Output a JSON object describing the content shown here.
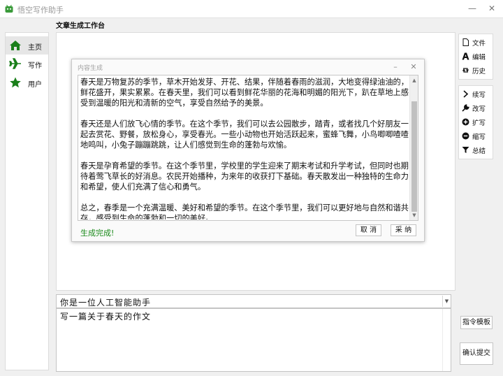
{
  "app": {
    "title": "悟空写作助手",
    "icon": "android-robot-icon",
    "accent_color": "#1a7f1a"
  },
  "sidebar": {
    "items": [
      {
        "label": "主页",
        "icon": "home-icon",
        "active": true
      },
      {
        "label": "写作",
        "icon": "airplane-icon",
        "active": false
      },
      {
        "label": "用户",
        "icon": "star-icon",
        "active": false
      }
    ]
  },
  "workspace": {
    "title": "文章生成工作台"
  },
  "dialog": {
    "title": "内容生成",
    "paragraphs": [
      "春天是万物复苏的季节，草木开始发芽、开花、结果，伴随着春雨的滋润，大地变得绿油油的，鲜花盛开，果实累累。在春天里，我们可以看到鲜花华丽的花海和明媚的阳光下，趴在草地上感受到温暖的阳光和清新的空气，享受自然给予的美景。",
      "春天还是人们放飞心情的季节。在这个季节，我们可以去公园散步，踏青，或者找几个好朋友一起去赏花、野餐，放松身心，享受春光。一些小动物也开始活跃起来，蜜蜂飞舞，小鸟唧唧喳喳地鸣叫，小兔子蹦蹦跳跳，让人们感觉到生命的蓬勃与欢愉。",
      "春天是孕育希望的季节。在这个季节里，学校里的学生迎来了期末考试和升学考试，但同时也期待着莺飞草长的好消息。农民开始播种，为来年的收获打下基础。春天散发出一种独特的生命力和希望，使人们充满了信心和勇气。",
      "总之，春季是一个充满温暖、美好和希望的季节。在这个季节里，我们可以更好地与自然和谐共存，感受到生命的蓬勃和一切的美好。"
    ],
    "status": "生成完成!",
    "status_color": "#1a8a1a",
    "cancel_label": "取 消",
    "accept_label": "采 纳"
  },
  "tools_top": [
    {
      "label": "文件",
      "icon": "file-icon"
    },
    {
      "label": "编辑",
      "icon": "font-icon"
    },
    {
      "label": "历史",
      "icon": "retweet-icon"
    }
  ],
  "tools_bottom": [
    {
      "label": "续写",
      "icon": "chevron-right-icon"
    },
    {
      "label": "改写",
      "icon": "wrench-icon"
    },
    {
      "label": "扩写",
      "icon": "plus-circle-icon"
    },
    {
      "label": "缩写",
      "icon": "minus-circle-icon"
    },
    {
      "label": "总结",
      "icon": "filter-icon"
    }
  ],
  "buttons": {
    "template_label": "指令模板",
    "submit_label": "确认提交"
  },
  "prompt": {
    "system_value": "你是一位人工智能助手",
    "user_value": "写一篇关于春天的作文"
  }
}
